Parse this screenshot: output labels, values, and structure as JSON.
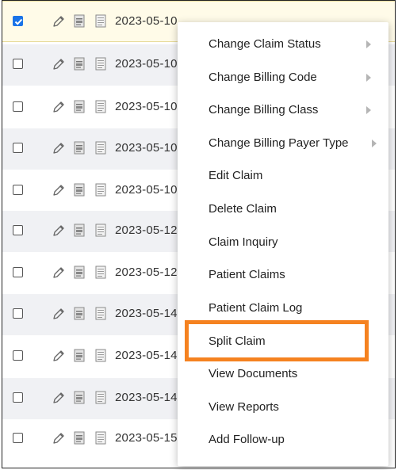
{
  "rows": [
    {
      "date": "2023-05-10",
      "checked": true
    },
    {
      "date": "2023-05-10",
      "checked": false
    },
    {
      "date": "2023-05-10",
      "checked": false
    },
    {
      "date": "2023-05-10",
      "checked": false
    },
    {
      "date": "2023-05-10",
      "checked": false
    },
    {
      "date": "2023-05-12",
      "checked": false
    },
    {
      "date": "2023-05-12",
      "checked": false
    },
    {
      "date": "2023-05-14",
      "checked": false
    },
    {
      "date": "2023-05-14",
      "checked": false
    },
    {
      "date": "2023-05-14",
      "checked": false
    },
    {
      "date": "2023-05-15",
      "checked": false
    }
  ],
  "context_menu": {
    "items": [
      {
        "label": "Change Claim Status",
        "submenu": true
      },
      {
        "label": "Change Billing Code",
        "submenu": true
      },
      {
        "label": "Change Billing Class",
        "submenu": true
      },
      {
        "label": "Change Billing Payer Type",
        "submenu": true
      },
      {
        "label": "Edit Claim",
        "submenu": false
      },
      {
        "label": "Delete Claim",
        "submenu": false
      },
      {
        "label": "Claim Inquiry",
        "submenu": false
      },
      {
        "label": "Patient Claims",
        "submenu": false
      },
      {
        "label": "Patient Claim Log",
        "submenu": false
      },
      {
        "label": "Split Claim",
        "submenu": false,
        "highlighted": true
      },
      {
        "label": "View Documents",
        "submenu": false
      },
      {
        "label": "View Reports",
        "submenu": false
      },
      {
        "label": "Add Follow-up",
        "submenu": false
      }
    ]
  },
  "colors": {
    "highlight_border": "#f58220",
    "checkbox_checked": "#1a73e8",
    "row_alt": "#f0f1f4",
    "row_selected": "#fffbe8"
  },
  "icons": [
    "pencil-icon",
    "document-icon",
    "notes-icon",
    "chevron-right-icon",
    "checkmark-icon"
  ]
}
